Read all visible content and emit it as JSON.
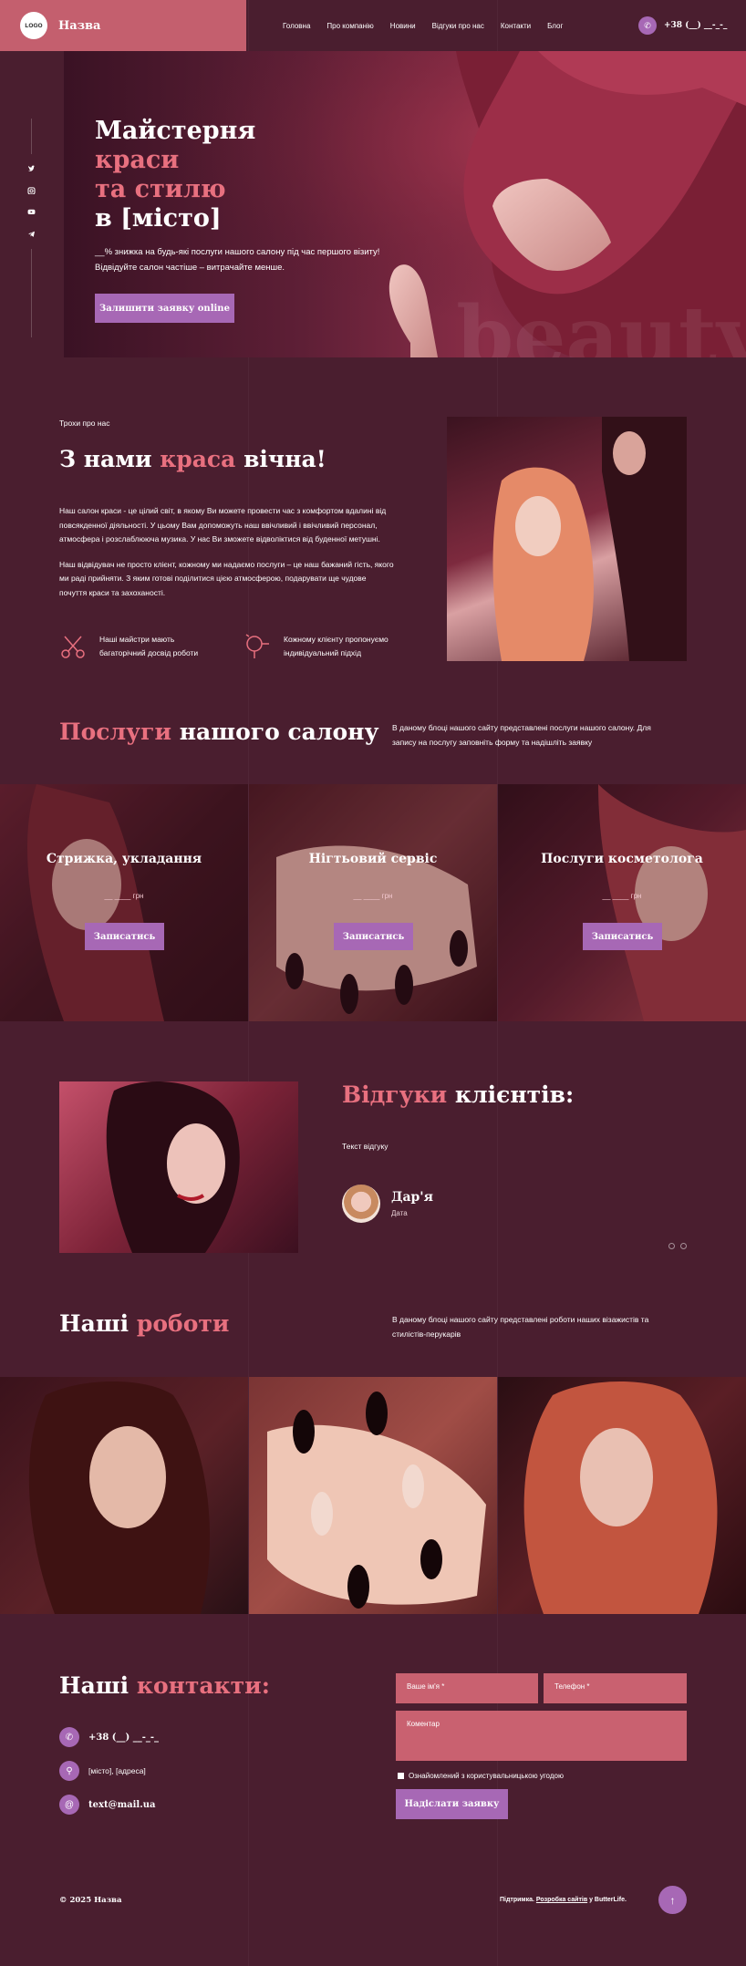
{
  "header": {
    "logo": "LOGO",
    "brand": "Назва",
    "nav": [
      "Головна",
      "Про компанію",
      "Новини",
      "Відгуки про нас",
      "Контакти",
      "Блог"
    ],
    "phone": "+38 (__) __-_-_"
  },
  "hero": {
    "title_line1": "Майстерня",
    "title_line2": "краси",
    "title_line3": "та стилю",
    "title_line4": "в [місто]",
    "text_line1": "__% знижка на будь-які послуги нашого салону під час першого візиту!",
    "text_line2": "Відвідуйте салон частіше – витрачайте менше.",
    "cta": "Залишити заявку online",
    "watermark": "beauty"
  },
  "social": [
    "twitter-icon",
    "instagram-icon",
    "youtube-icon",
    "telegram-icon"
  ],
  "about": {
    "kicker": "Трохи про нас",
    "title_a": "З нами ",
    "title_b": "краса",
    "title_c": " вічна!",
    "p1_line1": "Наш салон краси - це цілий світ, в якому Ви можете провести час з комфортом вдалині від",
    "p1_line2": "повсякденної діяльності. У цьому Вам допоможуть наш ввічливий і ввічливий персонал,",
    "p1_line3": "атмосфера і розслаблююча музика. У нас Ви зможете відволіктися від буденної метушні.",
    "p2_line1": "Наш відвідувач не просто клієнт, кожному ми надаємо послуги – це наш бажаний гість, якого",
    "p2_line2": "ми раді прийняти. З яким готові поділитися цією атмосферою, подарувати ще чудове",
    "p2_line3": "почуття краси та захоханості.",
    "feature1_line1": "Наші майстри мають",
    "feature1_line2": "багаторічний досвід роботи",
    "feature2_line1": "Кожному клієнту пропонуємо",
    "feature2_line2": "індивідуальний підхід"
  },
  "services": {
    "title_a": "Послуги",
    "title_b": " нашого салону",
    "desc_line1": "В даному блоці нашого сайту представлені послуги нашого салону. Для",
    "desc_line2": "запису на послугу заповніть форму та надішліть заявку",
    "items": [
      {
        "name": "Стрижка, укладання",
        "price": "__ ____ грн",
        "button": "Записатись"
      },
      {
        "name": "Нігтьовий сервіс",
        "price": "__ ____ грн",
        "button": "Записатись"
      },
      {
        "name": "Послуги косметолога",
        "price": "__ ____ грн",
        "button": "Записатись"
      }
    ]
  },
  "reviews": {
    "title_a": "Відгуки",
    "title_b": " клієнтів:",
    "text": "Текст відгуку",
    "name": "Дар'я",
    "date": "Дата"
  },
  "works": {
    "title_a": "Наші ",
    "title_b": "роботи",
    "desc_line1": "В даному блоці нашого сайту представлені роботи наших візажистів та",
    "desc_line2": "стилістів-перукарів"
  },
  "contacts": {
    "title_a": "Наші ",
    "title_b": "контакти:",
    "phone": "+38 (__) __-_-_",
    "address": "[місто], [адреса]",
    "email": "text@mail.ua",
    "form": {
      "name_placeholder": "Ваше ім'я *",
      "phone_placeholder": "Телефон *",
      "comment_placeholder": "Коментар",
      "agree": "Ознайомлений з користувальницькою угодою",
      "submit": "Надіслати заявку"
    }
  },
  "footer": {
    "copyright": "© 2025 Назва",
    "support_prefix": "Підтримка. ",
    "support_link": "Розробка сайтів",
    "support_suffix": " у ButterLife."
  },
  "colors": {
    "background": "#4a1e2f",
    "accent_pink": "#e8707f",
    "accent_purple": "#a768b5",
    "header_bar": "#c45f6e"
  }
}
